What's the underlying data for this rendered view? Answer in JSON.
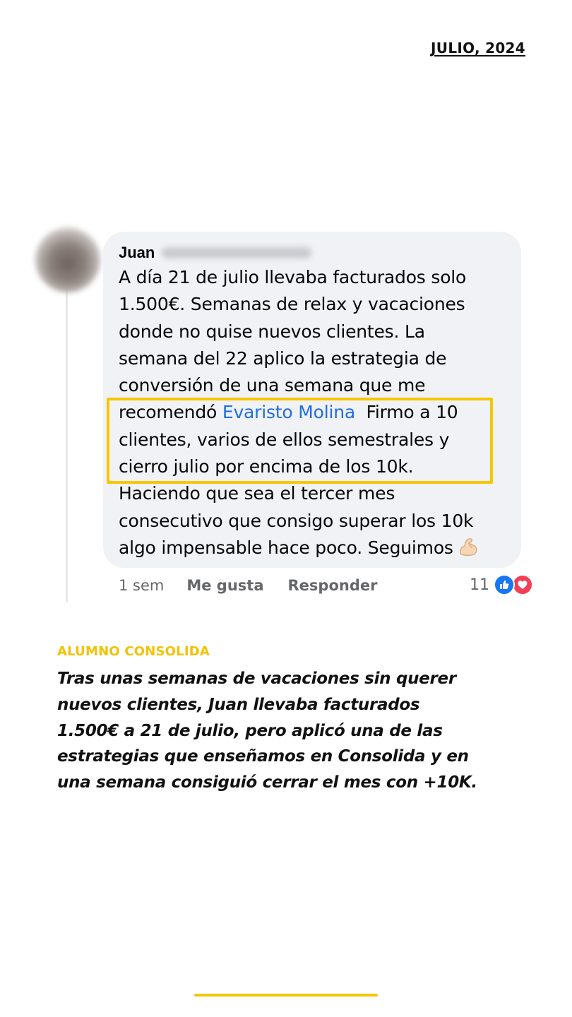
{
  "header": {
    "date": "JULIO, 2024"
  },
  "comment": {
    "author_first_name": "Juan",
    "author_last_name_blurred": true,
    "text_lines": [
      "A día 21 de julio llevaba facturados solo",
      "1.500€. Semanas de relax y vacaciones",
      "donde no quise nuevos clientes. La",
      "semana del 22 aplico la estrategia de",
      "conversión de una semana que me",
      "recomendó ",
      "clientes, varios de ellos semestrales y",
      "cierro julio por encima de los 10k.",
      "Haciendo que sea el tercer mes",
      "consecutivo que consigo superar los 10k",
      "algo impensable hace poco. Seguimos"
    ],
    "mention": "Evaristo Molina",
    "after_mention": "  Firmo a 10",
    "emoji": "flexed-biceps-icon",
    "highlight_color": "#f7c600",
    "mention_color": "#216fdb"
  },
  "actions": {
    "time": "1 sem",
    "like_label": "Me gusta",
    "reply_label": "Responder",
    "reaction_count": "11",
    "reaction_icons": [
      "like-icon",
      "love-icon"
    ]
  },
  "caption": {
    "label": "ALUMNO CONSOLIDA",
    "lines": [
      "Tras unas semanas de vacaciones sin querer",
      "nuevos clientes, Juan llevaba facturados",
      "1.500€ a 21 de julio, pero aplicó una de las",
      "estrategias que enseñamos en Consolida y en",
      "una semana consiguió cerrar el mes con +10K."
    ],
    "accent_color": "#f2c200"
  }
}
